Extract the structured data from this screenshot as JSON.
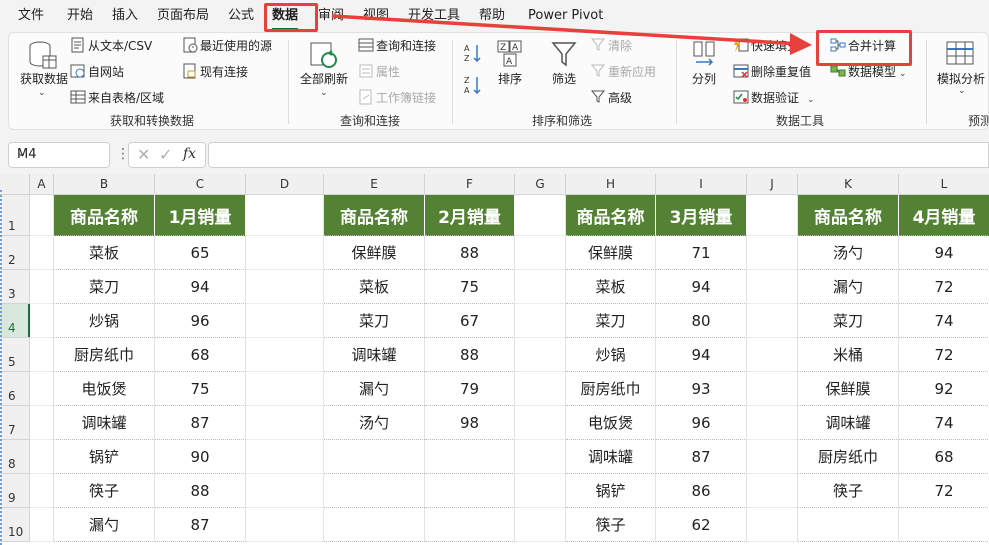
{
  "menu": {
    "items": [
      "文件",
      "开始",
      "插入",
      "页面布局",
      "公式",
      "数据",
      "审阅",
      "视图",
      "开发工具",
      "帮助",
      "Power Pivot"
    ],
    "active": "数据"
  },
  "ribbon": {
    "get_transform": {
      "get_data": "获取数据",
      "from_text_csv": "从文本/CSV",
      "from_web": "自网站",
      "from_table": "来自表格/区域",
      "recent_sources": "最近使用的源",
      "existing_connections": "现有连接",
      "label": "获取和转换数据"
    },
    "queries": {
      "refresh_all": "全部刷新",
      "queries_connections": "查询和连接",
      "properties": "属性",
      "workbook_links": "工作簿链接",
      "label": "查询和连接"
    },
    "sort_filter": {
      "sort": "排序",
      "filter": "筛选",
      "clear": "清除",
      "reapply": "重新应用",
      "advanced": "高级",
      "label": "排序和筛选"
    },
    "data_tools": {
      "text_to_columns": "分列",
      "flash_fill": "快速填充",
      "remove_duplicates": "删除重复值",
      "data_validation": "数据验证",
      "consolidate": "合并计算",
      "data_model": "数据模型",
      "label": "数据工具"
    },
    "forecast": {
      "what_if": "模拟分析",
      "label": "预测"
    }
  },
  "formula_bar": {
    "name_box": "M4",
    "fx": "fx",
    "formula": ""
  },
  "columns": [
    "A",
    "B",
    "C",
    "D",
    "E",
    "F",
    "G",
    "H",
    "I",
    "J",
    "K",
    "L"
  ],
  "rows": [
    "1",
    "2",
    "3",
    "4",
    "5",
    "6",
    "7",
    "8",
    "9",
    "10"
  ],
  "tables": [
    {
      "header": [
        "商品名称",
        "1月销量"
      ],
      "rows": [
        [
          "菜板",
          "65"
        ],
        [
          "菜刀",
          "94"
        ],
        [
          "炒锅",
          "96"
        ],
        [
          "厨房纸巾",
          "68"
        ],
        [
          "电饭煲",
          "75"
        ],
        [
          "调味罐",
          "87"
        ],
        [
          "锅铲",
          "90"
        ],
        [
          "筷子",
          "88"
        ],
        [
          "漏勺",
          "87"
        ]
      ]
    },
    {
      "header": [
        "商品名称",
        "2月销量"
      ],
      "rows": [
        [
          "保鲜膜",
          "88"
        ],
        [
          "菜板",
          "75"
        ],
        [
          "菜刀",
          "67"
        ],
        [
          "调味罐",
          "88"
        ],
        [
          "漏勺",
          "79"
        ],
        [
          "汤勺",
          "98"
        ],
        [
          "",
          ""
        ],
        [
          "",
          ""
        ],
        [
          "",
          ""
        ]
      ]
    },
    {
      "header": [
        "商品名称",
        "3月销量"
      ],
      "rows": [
        [
          "保鲜膜",
          "71"
        ],
        [
          "菜板",
          "94"
        ],
        [
          "菜刀",
          "80"
        ],
        [
          "炒锅",
          "94"
        ],
        [
          "厨房纸巾",
          "93"
        ],
        [
          "电饭煲",
          "96"
        ],
        [
          "调味罐",
          "87"
        ],
        [
          "锅铲",
          "86"
        ],
        [
          "筷子",
          "62"
        ]
      ]
    },
    {
      "header": [
        "商品名称",
        "4月销量"
      ],
      "rows": [
        [
          "汤勺",
          "94"
        ],
        [
          "漏勺",
          "72"
        ],
        [
          "菜刀",
          "74"
        ],
        [
          "米桶",
          "72"
        ],
        [
          "保鲜膜",
          "92"
        ],
        [
          "调味罐",
          "74"
        ],
        [
          "厨房纸巾",
          "68"
        ],
        [
          "筷子",
          "72"
        ],
        [
          "",
          ""
        ]
      ]
    }
  ],
  "colors": {
    "header_fill": "#548235",
    "highlight": "#e8403c",
    "accent": "#1e6e3a"
  }
}
